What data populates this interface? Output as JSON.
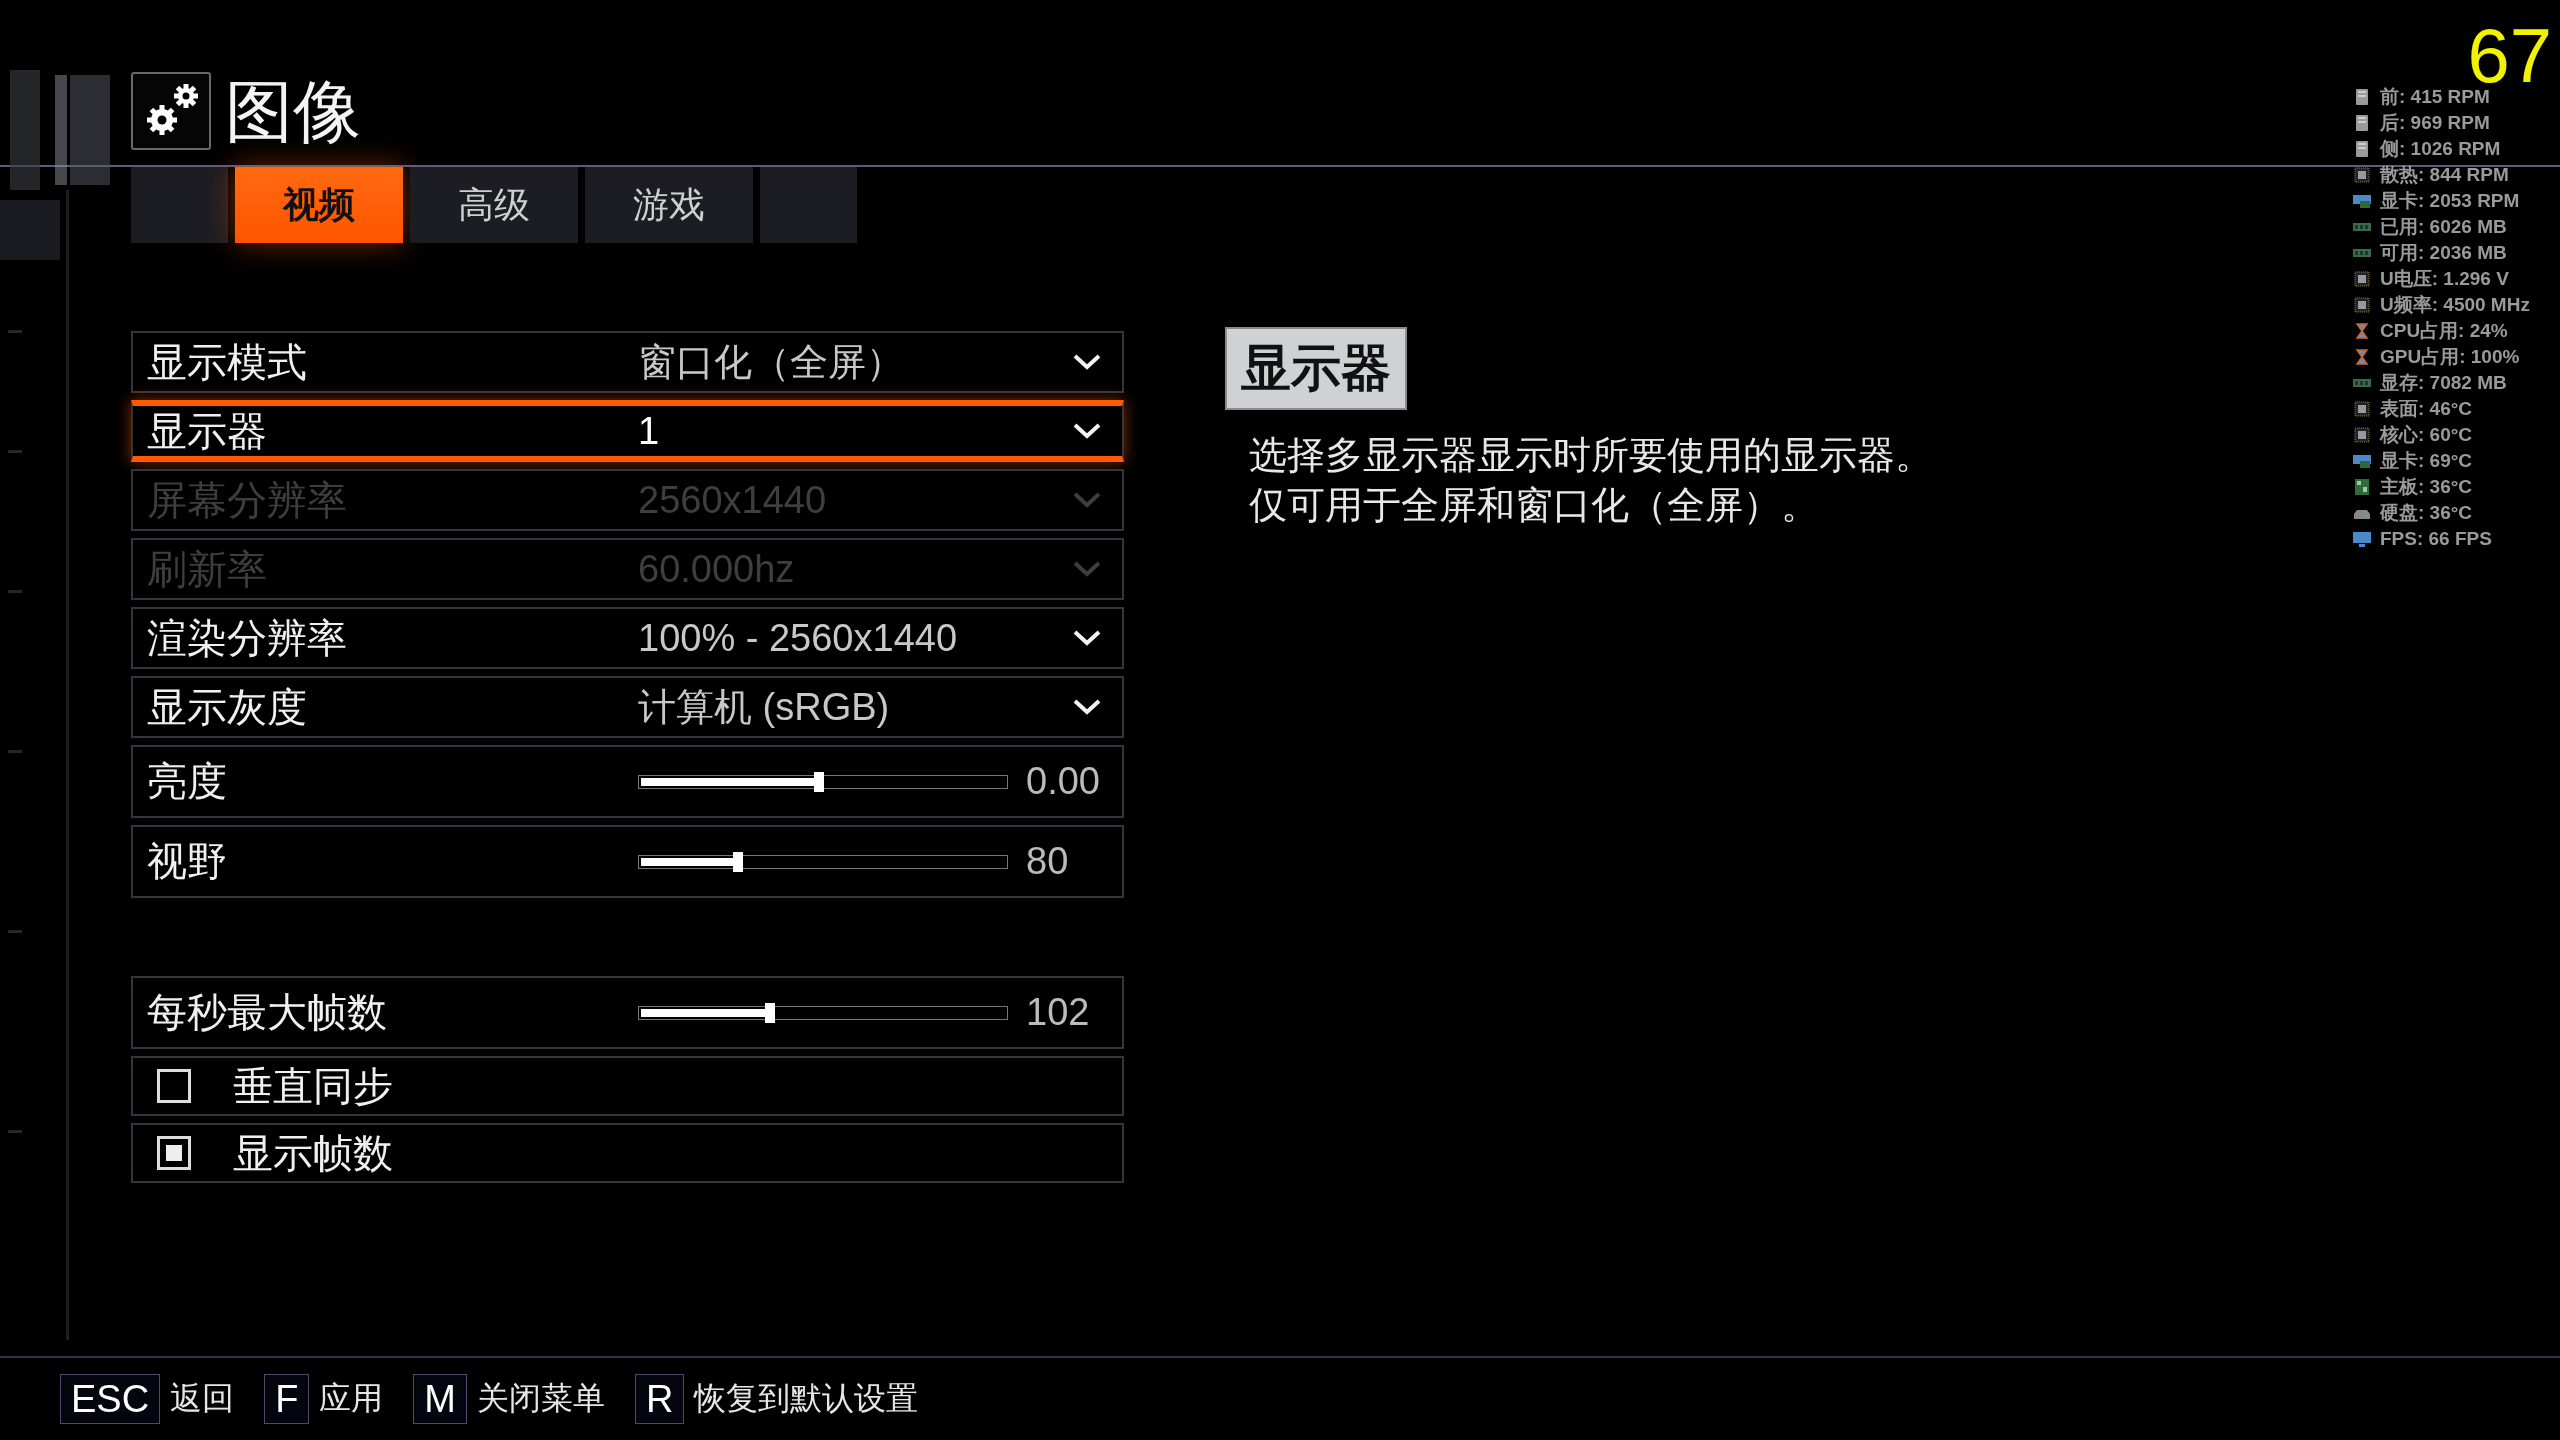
{
  "header": {
    "title": "图像"
  },
  "tabs": [
    {
      "kind": "blank",
      "selected": false
    },
    {
      "kind": "text",
      "label": "视频",
      "selected": true
    },
    {
      "kind": "text",
      "label": "高级",
      "selected": false
    },
    {
      "kind": "text",
      "label": "游戏",
      "selected": false
    },
    {
      "kind": "blank",
      "selected": false
    }
  ],
  "settings": [
    {
      "kind": "dropdown",
      "label": "显示模式",
      "value": "窗口化（全屏）",
      "selected": false,
      "disabled": false
    },
    {
      "kind": "dropdown",
      "label": "显示器",
      "value": "1",
      "selected": true,
      "disabled": false
    },
    {
      "kind": "dropdown",
      "label": "屏幕分辨率",
      "value": "2560x1440",
      "selected": false,
      "disabled": true
    },
    {
      "kind": "dropdown",
      "label": "刷新率",
      "value": "60.000hz",
      "selected": false,
      "disabled": true
    },
    {
      "kind": "dropdown",
      "label": "渲染分辨率",
      "value": "100% - 2560x1440",
      "selected": false,
      "disabled": false
    },
    {
      "kind": "dropdown",
      "label": "显示灰度",
      "value": "计算机 (sRGB)",
      "selected": false,
      "disabled": false
    },
    {
      "kind": "slider",
      "label": "亮度",
      "level": 0.49,
      "reading": "0.00",
      "selected": false
    },
    {
      "kind": "slider",
      "label": "视野",
      "level": 0.27,
      "reading": "80",
      "selected": false
    },
    {
      "kind": "spacer"
    },
    {
      "kind": "slider",
      "label": "每秒最大帧数",
      "level": 0.355,
      "reading": "102",
      "selected": false
    },
    {
      "kind": "checkbox",
      "label": "垂直同步",
      "checked": false,
      "selected": false
    },
    {
      "kind": "checkbox",
      "label": "显示帧数",
      "checked": true,
      "selected": false
    }
  ],
  "detail": {
    "heading": "显示器",
    "lines": [
      "选择多显示器显示时所要使用的显示器。",
      "仅可用于全屏和窗口化（全屏）。"
    ]
  },
  "overlay": {
    "fps": "67",
    "stats": [
      {
        "kind": "case",
        "text": "前: 415 RPM"
      },
      {
        "kind": "case",
        "text": "后: 969 RPM"
      },
      {
        "kind": "case",
        "text": "侧: 1026 RPM"
      },
      {
        "kind": "chip",
        "text": "散热: 844 RPM"
      },
      {
        "kind": "gpu",
        "text": "显卡: 2053 RPM"
      },
      {
        "kind": "ram",
        "text": "已用: 6026 MB"
      },
      {
        "kind": "ram",
        "text": "可用: 2036 MB"
      },
      {
        "kind": "chip",
        "text": "U电压: 1.296 V"
      },
      {
        "kind": "chip",
        "text": "U频率: 4500 MHz"
      },
      {
        "kind": "hourglass",
        "text": "CPU占用: 24%"
      },
      {
        "kind": "hourglass",
        "text": "GPU占用: 100%"
      },
      {
        "kind": "ram",
        "text": "显存: 7082 MB"
      },
      {
        "kind": "chip",
        "text": "表面: 46°C"
      },
      {
        "kind": "chip",
        "text": "核心: 60°C"
      },
      {
        "kind": "gpu",
        "text": "显卡: 69°C"
      },
      {
        "kind": "board",
        "text": "主板: 36°C"
      },
      {
        "kind": "disk",
        "text": "硬盘: 36°C"
      },
      {
        "kind": "monitor",
        "text": "FPS: 66 FPS"
      }
    ]
  },
  "footer": {
    "keys": [
      {
        "key": "ESC",
        "label": "返回"
      },
      {
        "key": "F",
        "label": "应用"
      },
      {
        "key": "M",
        "label": "关闭菜单"
      },
      {
        "key": "R",
        "label": "恢复到默认设置"
      }
    ]
  }
}
